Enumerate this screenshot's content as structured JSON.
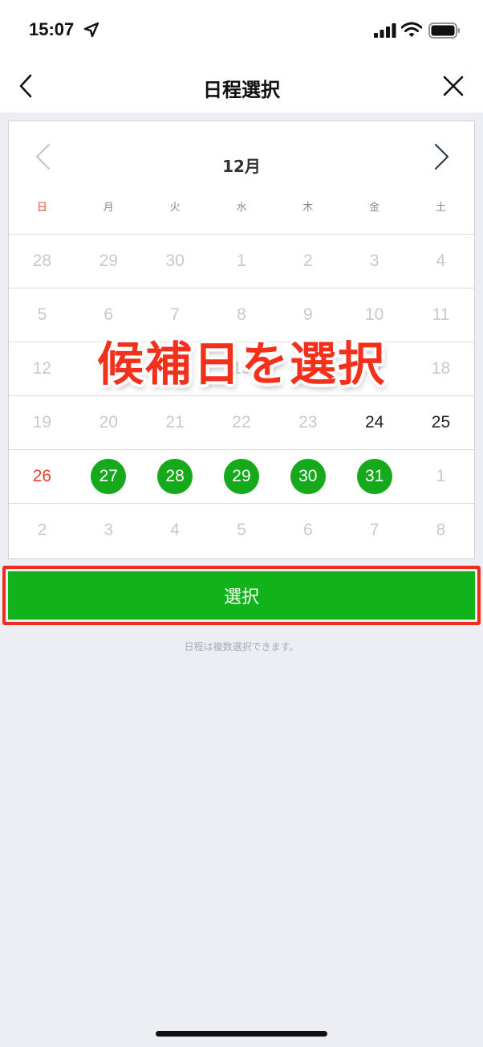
{
  "status_bar": {
    "time": "15:07",
    "icons": [
      "location-icon",
      "signal-icon",
      "wifi-icon",
      "battery-icon"
    ]
  },
  "nav": {
    "title": "日程選択",
    "back_icon": "chevron-left-icon",
    "close_icon": "close-icon"
  },
  "calendar": {
    "month": "12月",
    "weekdays": [
      "日",
      "月",
      "火",
      "水",
      "木",
      "金",
      "土"
    ],
    "weeks": [
      [
        "28",
        "29",
        "30",
        "1",
        "2",
        "3",
        "4"
      ],
      [
        "5",
        "6",
        "7",
        "8",
        "9",
        "10",
        "11"
      ],
      [
        "12",
        "13",
        "14",
        "15",
        "16",
        "17",
        "18"
      ],
      [
        "19",
        "20",
        "21",
        "22",
        "23",
        "24",
        "25"
      ],
      [
        "26",
        "27",
        "28",
        "29",
        "30",
        "31",
        "1"
      ],
      [
        "2",
        "3",
        "4",
        "5",
        "6",
        "7",
        "8"
      ]
    ],
    "active_days": [
      "24",
      "25",
      "26"
    ],
    "selected_days": [
      "27",
      "28",
      "29",
      "30",
      "31"
    ],
    "colors": {
      "selected": "#15a91b",
      "sunday": "#ea3f2a",
      "disabled": "#c8c9cc"
    }
  },
  "overlay": {
    "caption": "候補日を選択"
  },
  "actions": {
    "select_label": "選択",
    "hint": "日程は複数選択できます。"
  }
}
